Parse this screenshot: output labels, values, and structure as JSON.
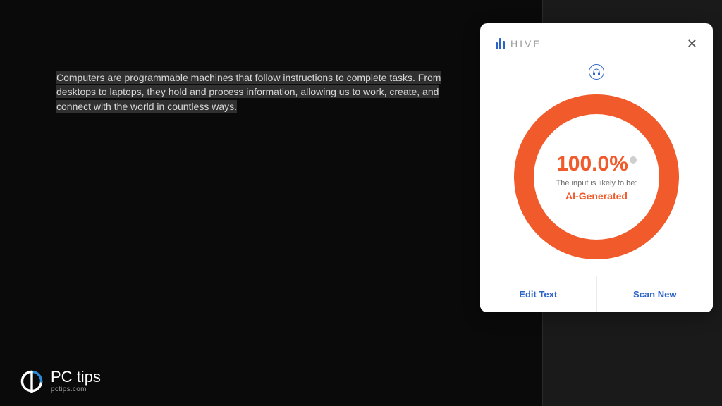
{
  "content": {
    "paragraph": "Computers are programmable machines that follow instructions to complete tasks. From desktops to laptops, they hold and process information, allowing us to work, create, and connect with the world in countless ways."
  },
  "hive": {
    "brand": "HIVE",
    "percent": "100.0%",
    "likely_label": "The input is likely to be:",
    "verdict": "AI-Generated",
    "edit_label": "Edit Text",
    "scan_label": "Scan New"
  },
  "watermark": {
    "title_a": "PC",
    "title_b": "tips",
    "url": "pctips.com"
  },
  "colors": {
    "accent_orange": "#f15a2b",
    "accent_blue": "#2b63c9"
  }
}
